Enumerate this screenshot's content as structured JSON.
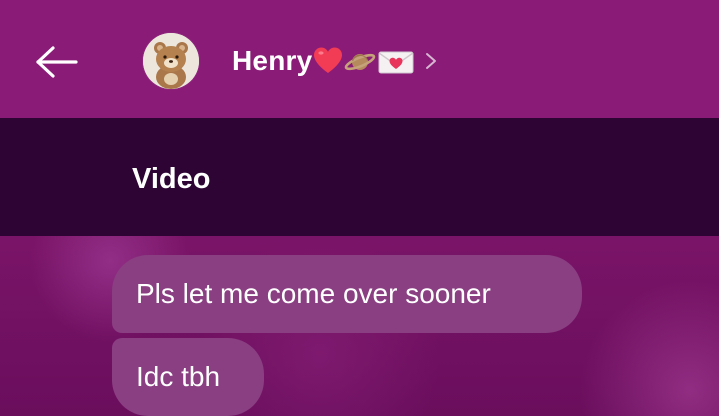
{
  "header": {
    "contact_name": "Henry",
    "name_emojis": [
      "heart-emoji",
      "planet-emoji",
      "love-letter-emoji"
    ],
    "avatar_icon": "teddy-bear-avatar",
    "back_icon": "back-arrow-icon",
    "chevron_icon": "chevron-right-icon",
    "background_color": "#8a1b77"
  },
  "video": {
    "label": "Video"
  },
  "messages": [
    {
      "text": "Pls let me come over sooner"
    },
    {
      "text": "Idc tbh"
    }
  ],
  "colors": {
    "video_bar": "#2d0433",
    "bubble": "#8a3f82",
    "chat_bg": "#6e0f5f"
  }
}
